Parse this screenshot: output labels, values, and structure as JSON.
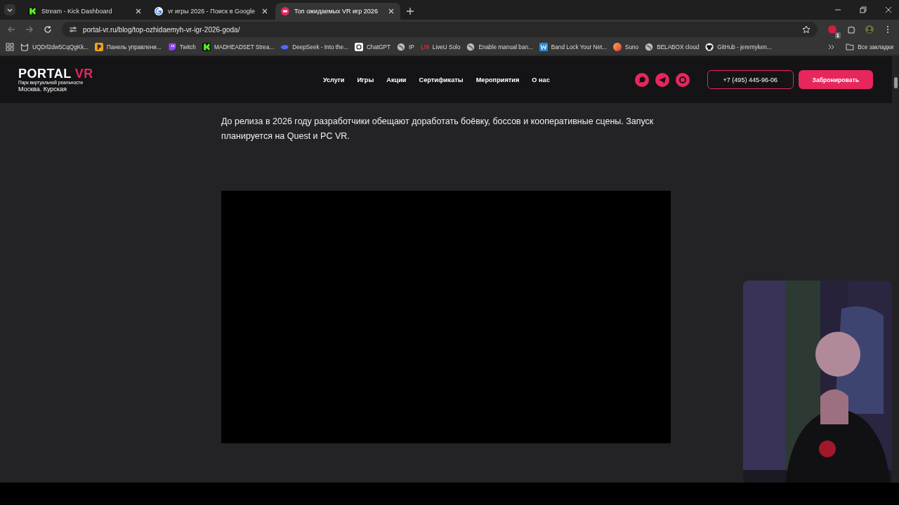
{
  "browser": {
    "tabs": [
      {
        "title": "Stream - Kick Dashboard",
        "selected": false
      },
      {
        "title": "vr игры 2026 - Поиск в Google",
        "selected": false
      },
      {
        "title": "Топ ожидаемых VR игр 2026",
        "selected": true
      }
    ],
    "url": "portal-vr.ru/blog/top-ozhidaemyh-vr-igr-2026-goda/",
    "extension_badge": "1",
    "bookmarks": [
      "UQDrl2dw5CqQgKk...",
      "Панель управлени...",
      "Twitch",
      "MADHEADSET Strea...",
      "DeepSeek - Into the...",
      "ChatGPT",
      "IP",
      "LiveU Solo",
      "Enable manual ban...",
      "Band Lock Your Net...",
      "Suno",
      "BELABOX cloud",
      "GitHub - jeremyken..."
    ],
    "all_bookmarks": "Все закладки"
  },
  "site": {
    "logo": {
      "word1": "PORTAL",
      "word2": "VR",
      "tagline": "Парк виртуальной реальности",
      "location": "Москва. Курская"
    },
    "nav": [
      "Услуги",
      "Игры",
      "Акции",
      "Сертификаты",
      "Мероприятия",
      "О нас"
    ],
    "phone": "+7 (495) 445-96-06",
    "book_button": "Забронировать"
  },
  "article": {
    "paragraph": "До релиза в 2026 году разработчики обещают доработать боёвку, боссов и кооперативные сцены. Запуск планируется на Quest и PC VR.",
    "video": {
      "kind": "video"
    }
  }
}
